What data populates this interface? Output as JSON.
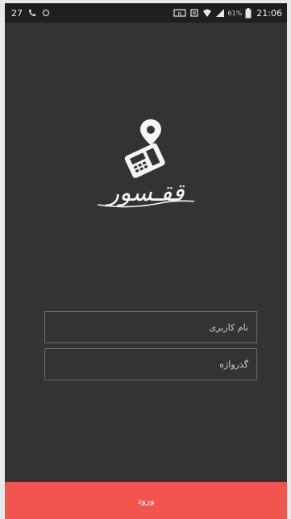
{
  "status_bar": {
    "notification_count": "27",
    "battery_percent": "61%",
    "time": "21:06"
  },
  "logo": {
    "text": "ققـسور"
  },
  "form": {
    "username_placeholder": "نام کاربری",
    "password_placeholder": "گذرواژه"
  },
  "login_button": {
    "label": "ورود"
  },
  "colors": {
    "background": "#333333",
    "status_bar": "#1f1f1f",
    "accent": "#f2544f"
  }
}
